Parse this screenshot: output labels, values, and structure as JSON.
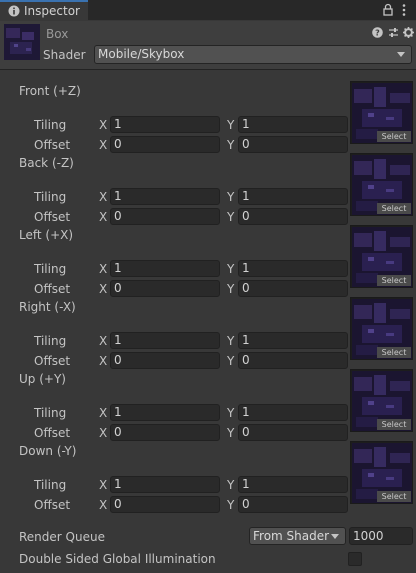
{
  "tab": {
    "title": "Inspector",
    "icon": "info-icon"
  },
  "toolbar_icons": [
    "lock-icon",
    "kebab-menu-icon"
  ],
  "material": {
    "name": "Box",
    "shader_label": "Shader",
    "shader_value": "Mobile/Skybox",
    "header_icons": [
      "help-icon",
      "preset-sliders-icon",
      "gear-icon"
    ]
  },
  "tiling_label": "Tiling",
  "offset_label": "Offset",
  "x_label": "X",
  "y_label": "Y",
  "select_label": "Select",
  "textures": [
    {
      "title": "Front (+Z)",
      "tiling_x": "1",
      "tiling_y": "1",
      "offset_x": "0",
      "offset_y": "0"
    },
    {
      "title": "Back (-Z)",
      "tiling_x": "1",
      "tiling_y": "1",
      "offset_x": "0",
      "offset_y": "0"
    },
    {
      "title": "Left (+X)",
      "tiling_x": "1",
      "tiling_y": "1",
      "offset_x": "0",
      "offset_y": "0"
    },
    {
      "title": "Right (-X)",
      "tiling_x": "1",
      "tiling_y": "1",
      "offset_x": "0",
      "offset_y": "0"
    },
    {
      "title": "Up (+Y)",
      "tiling_x": "1",
      "tiling_y": "1",
      "offset_x": "0",
      "offset_y": "0"
    },
    {
      "title": "Down (-Y)",
      "tiling_x": "1",
      "tiling_y": "1",
      "offset_x": "0",
      "offset_y": "0"
    }
  ],
  "render_queue": {
    "label": "Render Queue",
    "mode": "From Shader",
    "value": "1000"
  },
  "double_sided_gi": {
    "label": "Double Sided Global Illumination",
    "checked": false
  },
  "colors": {
    "accent": "#3a72b0",
    "panel": "#383838",
    "field": "#2a2a2a",
    "thumb": "#2a1f45"
  }
}
